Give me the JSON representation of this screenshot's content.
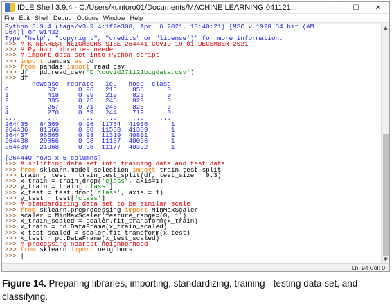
{
  "window": {
    "title": "IDLE Shell 3.9.4 - C:/Users/kuntoro01/Documents/MACHINE LEARNING 041121...",
    "controls": [
      "—",
      "☐",
      "✕"
    ]
  },
  "menu": [
    "File",
    "Edit",
    "Shell",
    "Debug",
    "Options",
    "Window",
    "Help"
  ],
  "shell_lines": [
    {
      "segs": [
        {
          "t": "Python 3.9.4 (tags/v3.9.4:1f2e308, Apr  6 2021, 13:40:21) [MSC v.1928 64 bit (AM",
          "c": "out"
        }
      ]
    },
    {
      "segs": [
        {
          "t": "D64)] on win32",
          "c": "out"
        }
      ]
    },
    {
      "segs": [
        {
          "t": "Type \"help\", \"copyright\", \"credits\" or \"license()\" for more information.",
          "c": "out"
        }
      ]
    },
    {
      "segs": [
        {
          "t": ">>> ",
          "c": "prm"
        },
        {
          "t": "# K NEAREST NEIGHBORS SISE 264441 COVID 19 01 DECEMBER 2021",
          "c": "com"
        }
      ]
    },
    {
      "segs": [
        {
          "t": ">>> ",
          "c": "prm"
        },
        {
          "t": "# Python libraries needed",
          "c": "com"
        }
      ]
    },
    {
      "segs": [
        {
          "t": ">>> ",
          "c": "prm"
        },
        {
          "t": "# import data set into Python script",
          "c": "com"
        }
      ]
    },
    {
      "segs": [
        {
          "t": ">>> ",
          "c": "prm"
        },
        {
          "t": "import",
          "c": "kw"
        },
        {
          "t": " pandas ",
          "c": ""
        },
        {
          "t": "as",
          "c": "kw"
        },
        {
          "t": " pd",
          "c": ""
        }
      ]
    },
    {
      "segs": [
        {
          "t": ">>> ",
          "c": "prm"
        },
        {
          "t": "from",
          "c": "kw"
        },
        {
          "t": " pandas ",
          "c": ""
        },
        {
          "t": "import",
          "c": "kw"
        },
        {
          "t": " read_csv",
          "c": ""
        }
      ]
    },
    {
      "segs": [
        {
          "t": ">>> ",
          "c": "prm"
        },
        {
          "t": "df = pd.read_csv(",
          "c": ""
        },
        {
          "t": "'D:\\covid271121bigdata.csv'",
          "c": "str"
        },
        {
          "t": ")",
          "c": ""
        }
      ]
    },
    {
      "segs": [
        {
          "t": ">>> ",
          "c": "prm"
        },
        {
          "t": "df",
          "c": ""
        }
      ]
    },
    {
      "segs": [
        {
          "t": "       newcase  reprate   icu   hosp  class",
          "c": "out"
        }
      ]
    },
    {
      "segs": [
        {
          "t": "0          531     0.96   215    856      0",
          "c": "out"
        }
      ]
    },
    {
      "segs": [
        {
          "t": "1          418     0.99   219    823      0",
          "c": "out"
        }
      ]
    },
    {
      "segs": [
        {
          "t": "2          395     0.75   245    829      0",
          "c": "out"
        }
      ]
    },
    {
      "segs": [
        {
          "t": "3          257     0.71   245    826      0",
          "c": "out"
        }
      ]
    },
    {
      "segs": [
        {
          "t": "4          270     0.69   244    712      0",
          "c": "out"
        }
      ]
    },
    {
      "segs": [
        {
          "t": "...        ...      ...   ...    ...    ...",
          "c": "out"
        }
      ]
    },
    {
      "segs": [
        {
          "t": "264435   84369     0.96  11754  41936      1",
          "c": "out"
        }
      ]
    },
    {
      "segs": [
        {
          "t": "264436   81566     0.98  11533  41309      1",
          "c": "out"
        }
      ]
    },
    {
      "segs": [
        {
          "t": "264437   96665     0.98  11319  40801      1",
          "c": "out"
        }
      ]
    },
    {
      "segs": [
        {
          "t": "264438   29856     0.98  11167  40036      1",
          "c": "out"
        }
      ]
    },
    {
      "segs": [
        {
          "t": "264439   21968     0.98  11177  40392      1",
          "c": "out"
        }
      ]
    },
    {
      "segs": [
        {
          "t": "",
          "c": "out"
        }
      ]
    },
    {
      "segs": [
        {
          "t": "[264440 rows x 5 columns]",
          "c": "out"
        }
      ]
    },
    {
      "segs": [
        {
          "t": ">>> ",
          "c": "prm"
        },
        {
          "t": "# splitting data set into training data and test data",
          "c": "com"
        }
      ]
    },
    {
      "segs": [
        {
          "t": ">>> ",
          "c": "prm"
        },
        {
          "t": "from",
          "c": "kw"
        },
        {
          "t": " sklearn.model_selection ",
          "c": ""
        },
        {
          "t": "import",
          "c": "kw"
        },
        {
          "t": " train_test_split",
          "c": ""
        }
      ]
    },
    {
      "segs": [
        {
          "t": ">>> ",
          "c": "prm"
        },
        {
          "t": "train , test = train_test_split(df, test_size = 0.3)",
          "c": ""
        }
      ]
    },
    {
      "segs": [
        {
          "t": ">>> ",
          "c": "prm"
        },
        {
          "t": "x_train = train.drop(",
          "c": ""
        },
        {
          "t": "'class'",
          "c": "str"
        },
        {
          "t": ", axis=1)",
          "c": ""
        }
      ]
    },
    {
      "segs": [
        {
          "t": ">>> ",
          "c": "prm"
        },
        {
          "t": "y_train = train[",
          "c": ""
        },
        {
          "t": "'class'",
          "c": "str"
        },
        {
          "t": "]",
          "c": ""
        }
      ]
    },
    {
      "segs": [
        {
          "t": ">>> ",
          "c": "prm"
        },
        {
          "t": "x_test = test.drop(",
          "c": ""
        },
        {
          "t": "'class'",
          "c": "str"
        },
        {
          "t": ", axis = 1)",
          "c": ""
        }
      ]
    },
    {
      "segs": [
        {
          "t": ">>> ",
          "c": "prm"
        },
        {
          "t": "y_test = test[",
          "c": ""
        },
        {
          "t": "'class'",
          "c": "str"
        },
        {
          "t": "]",
          "c": ""
        }
      ]
    },
    {
      "segs": [
        {
          "t": ">>> ",
          "c": "prm"
        },
        {
          "t": "# standardizing data set to be similar scale",
          "c": "com"
        }
      ]
    },
    {
      "segs": [
        {
          "t": ">>> ",
          "c": "prm"
        },
        {
          "t": "from",
          "c": "kw"
        },
        {
          "t": " sklearn.preprocessing ",
          "c": ""
        },
        {
          "t": "import",
          "c": "kw"
        },
        {
          "t": " MinMaxScaler",
          "c": ""
        }
      ]
    },
    {
      "segs": [
        {
          "t": ">>> ",
          "c": "prm"
        },
        {
          "t": "scaler = MinMaxScaler(feature_range=(0, 1))",
          "c": ""
        }
      ]
    },
    {
      "segs": [
        {
          "t": ">>> ",
          "c": "prm"
        },
        {
          "t": "x_train_scaled = scaler.fit_transform(x_train)",
          "c": ""
        }
      ]
    },
    {
      "segs": [
        {
          "t": ">>> ",
          "c": "prm"
        },
        {
          "t": "x_train = pd.DataFrame(x_train_scaled)",
          "c": ""
        }
      ]
    },
    {
      "segs": [
        {
          "t": ">>> ",
          "c": "prm"
        },
        {
          "t": "x_test_scaled = scaler.fit_transform(x_test)",
          "c": ""
        }
      ]
    },
    {
      "segs": [
        {
          "t": ">>> ",
          "c": "prm"
        },
        {
          "t": "x_test = pd.DataFrame(x_test_scaled)",
          "c": ""
        }
      ]
    },
    {
      "segs": [
        {
          "t": ">>> ",
          "c": "prm"
        },
        {
          "t": "# processing nearest neighborhood",
          "c": "com"
        }
      ]
    },
    {
      "segs": [
        {
          "t": ">>> ",
          "c": "prm"
        },
        {
          "t": "from",
          "c": "kw"
        },
        {
          "t": " sklearn ",
          "c": ""
        },
        {
          "t": "import",
          "c": "kw"
        },
        {
          "t": " neighbors",
          "c": ""
        }
      ]
    },
    {
      "segs": [
        {
          "t": ">>> ",
          "c": "prm"
        },
        {
          "t": "|",
          "c": ""
        }
      ]
    }
  ],
  "status": {
    "position": "Ln: 94  Col: 0"
  },
  "caption": {
    "label": "Figure 14.",
    "text": " Preparing libraries, importing, standardizing, training - testing data set, and classifying."
  },
  "colors": {
    "output": "#1d1de0",
    "prompt": "#7a3a00",
    "keyword": "#ff7700",
    "comment": "#dd0000",
    "string": "#008800"
  }
}
